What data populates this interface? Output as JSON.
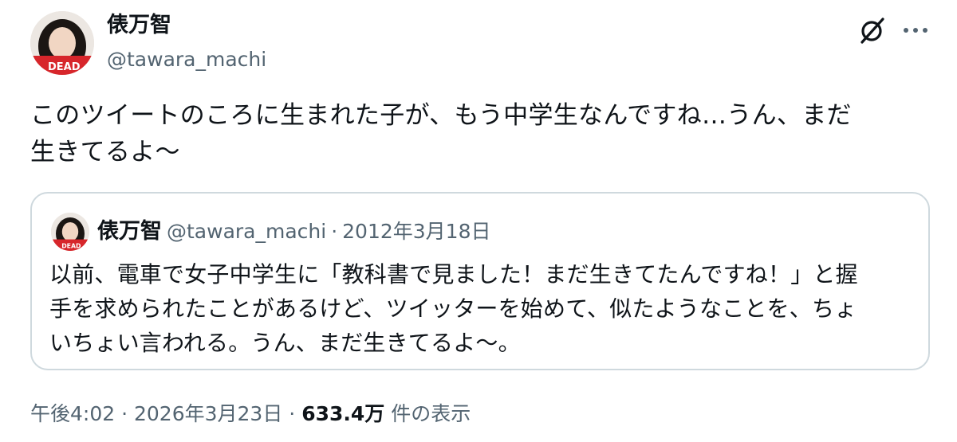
{
  "author": {
    "name": "俵万智",
    "handle": "@tawara_machi",
    "avatar_text": "DEAD"
  },
  "tweet": {
    "text": "このツイートのころに生まれた子が、もう中学生なんですね…うん、まだ\n生きてるよ〜"
  },
  "quoted_tweet": {
    "name": "俵万智",
    "handle": "@tawara_machi",
    "separator": "·",
    "date": "2012年3月18日",
    "text": "以前、電車で女子中学生に「教科書で見ました！まだ生きてたんですね！」と握\n手を求められたことがあるけど、ツイッターを始めて、似たようなことを、ちょ\nいちょい言われる。うん、まだ生きてるよ〜。"
  },
  "meta": {
    "time": "午後4:02",
    "separator": "·",
    "date": "2026年3月23日",
    "separator2": "·",
    "views_count": "633.4万",
    "views_label": "件の表示"
  },
  "icons": {
    "grok": "grok-icon",
    "more": "more-icon"
  },
  "colors": {
    "text": "#0f1419",
    "secondary": "#536471",
    "border": "#cfd9de",
    "avatar_badge": "#d7262b"
  }
}
